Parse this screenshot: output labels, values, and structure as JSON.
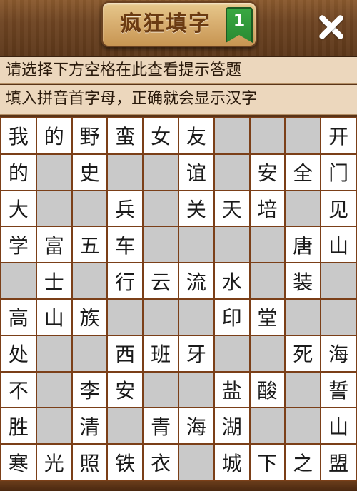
{
  "header": {
    "title": "疯狂填字",
    "level": "1"
  },
  "hints": {
    "line1": "请选择下方空格在此查看提示答题",
    "line2": "填入拼音首字母，正确就会显示汉字"
  },
  "grid": [
    [
      "我",
      "的",
      "野",
      "蛮",
      "女",
      "友",
      "",
      "",
      "",
      "开"
    ],
    [
      "的",
      "",
      "史",
      "",
      "",
      "谊",
      "",
      "安",
      "全",
      "门"
    ],
    [
      "大",
      "",
      "",
      "兵",
      "",
      "关",
      "天",
      "培",
      "",
      "见"
    ],
    [
      "学",
      "富",
      "五",
      "车",
      "",
      "",
      "",
      "",
      "唐",
      "山"
    ],
    [
      "",
      "士",
      "",
      "行",
      "云",
      "流",
      "水",
      "",
      "装",
      ""
    ],
    [
      "高",
      "山",
      "族",
      "",
      "",
      "",
      "印",
      "堂",
      "",
      ""
    ],
    [
      "处",
      "",
      "",
      "西",
      "班",
      "牙",
      "",
      "",
      "死",
      "海"
    ],
    [
      "不",
      "",
      "李",
      "安",
      "",
      "",
      "盐",
      "酸",
      "",
      "誓"
    ],
    [
      "胜",
      "",
      "清",
      "",
      "青",
      "海",
      "湖",
      "",
      "",
      "山"
    ],
    [
      "寒",
      "光",
      "照",
      "铁",
      "衣",
      "",
      "城",
      "下",
      "之",
      "盟"
    ]
  ]
}
